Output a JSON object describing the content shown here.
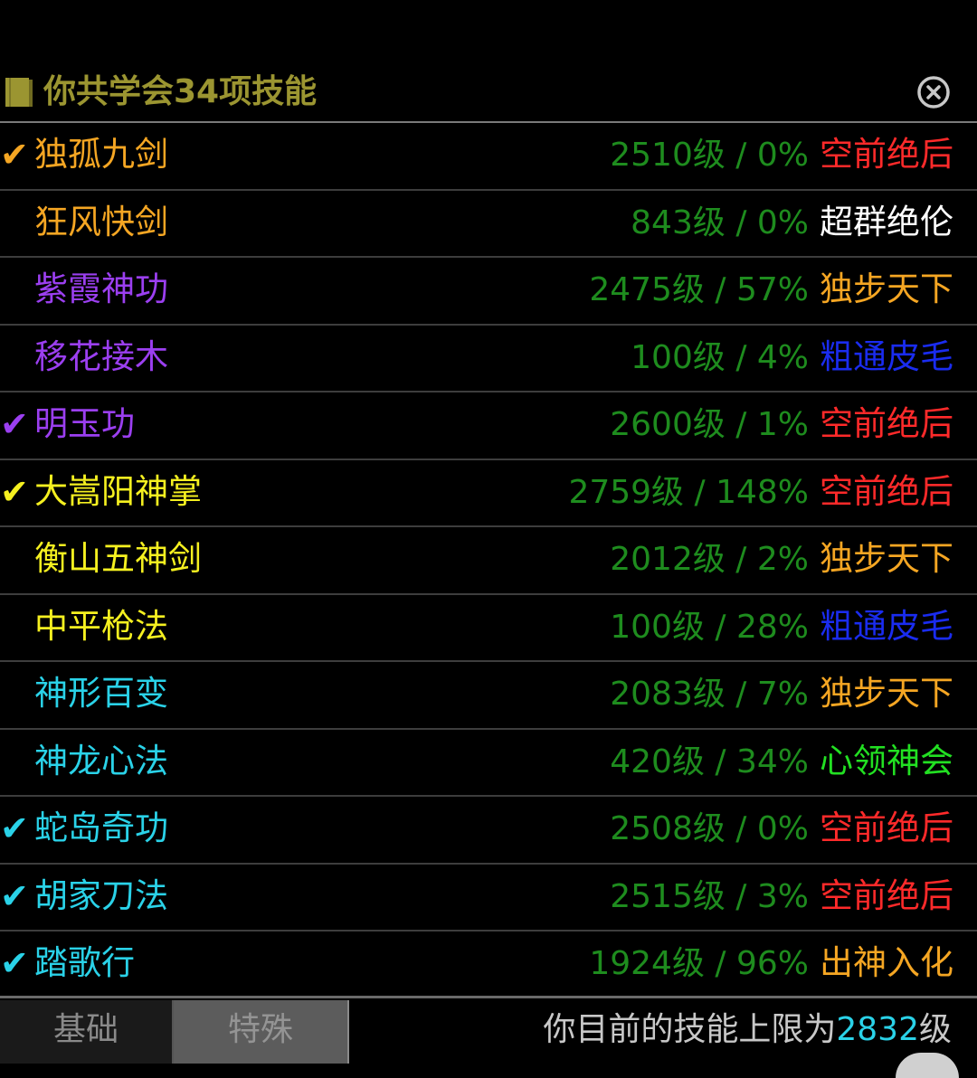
{
  "header": {
    "title": "你共学会34项技能",
    "book_color": "#9b9531"
  },
  "skills": [
    {
      "check": "✔",
      "name": "独孤九剑",
      "name_color": "#f5a623",
      "stats": "2510级 / 0%",
      "rank": "空前绝后",
      "rank_color": "#ff2a2a"
    },
    {
      "check": "",
      "name": "狂风快剑",
      "name_color": "#f5a623",
      "stats": "843级 / 0%",
      "rank": "超群绝伦",
      "rank_color": "#ffffff"
    },
    {
      "check": "",
      "name": "紫霞神功",
      "name_color": "#9b3ff0",
      "stats": "2475级 / 57%",
      "rank": "独步天下",
      "rank_color": "#f5a623"
    },
    {
      "check": "",
      "name": "移花接木",
      "name_color": "#9b3ff0",
      "stats": "100级 / 4%",
      "rank": "粗通皮毛",
      "rank_color": "#1a2cf0"
    },
    {
      "check": "✔",
      "name": "明玉功",
      "name_color": "#9b3ff0",
      "stats": "2600级 / 1%",
      "rank": "空前绝后",
      "rank_color": "#ff2a2a"
    },
    {
      "check": "✔",
      "name": "大嵩阳神掌",
      "name_color": "#f5f020",
      "stats": "2759级 / 148%",
      "rank": "空前绝后",
      "rank_color": "#ff2a2a"
    },
    {
      "check": "",
      "name": "衡山五神剑",
      "name_color": "#f5f020",
      "stats": "2012级 / 2%",
      "rank": "独步天下",
      "rank_color": "#f5a623"
    },
    {
      "check": "",
      "name": "中平枪法",
      "name_color": "#f5f020",
      "stats": "100级 / 28%",
      "rank": "粗通皮毛",
      "rank_color": "#1a2cf0"
    },
    {
      "check": "",
      "name": "神形百变",
      "name_color": "#2ad2e8",
      "stats": "2083级 / 7%",
      "rank": "独步天下",
      "rank_color": "#f5a623"
    },
    {
      "check": "",
      "name": "神龙心法",
      "name_color": "#2ad2e8",
      "stats": "420级 / 34%",
      "rank": "心领神会",
      "rank_color": "#22e022"
    },
    {
      "check": "✔",
      "name": "蛇岛奇功",
      "name_color": "#2ad2e8",
      "stats": "2508级 / 0%",
      "rank": "空前绝后",
      "rank_color": "#ff2a2a"
    },
    {
      "check": "✔",
      "name": "胡家刀法",
      "name_color": "#2ad2e8",
      "stats": "2515级 / 3%",
      "rank": "空前绝后",
      "rank_color": "#ff2a2a"
    },
    {
      "check": "✔",
      "name": "踏歌行",
      "name_color": "#2ad2e8",
      "stats": "1924级 / 96%",
      "rank": "出神入化",
      "rank_color": "#f5a623"
    }
  ],
  "footer": {
    "tab_basic": "基础",
    "tab_special": "特殊",
    "limit_prefix": "你目前的技能上限为",
    "limit_value": "2832",
    "limit_suffix": "级"
  }
}
